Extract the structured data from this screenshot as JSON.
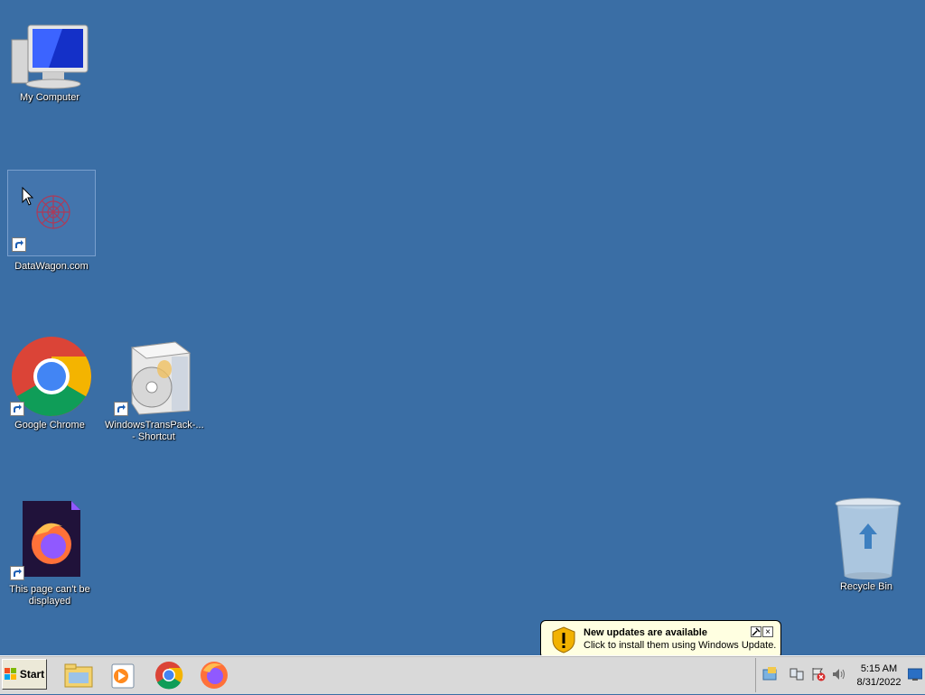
{
  "desktop": {
    "background": "#3a6ea5",
    "icons": [
      {
        "label": "My Computer",
        "icon": "computer-icon"
      },
      {
        "label": "DataWagon.com",
        "icon": "datawagon-icon"
      },
      {
        "label": "Google Chrome",
        "icon": "chrome-icon"
      },
      {
        "label": "WindowsTransPack-...\n- Shortcut",
        "icon": "installer-box-icon"
      },
      {
        "label": "This page can't be\ndisplayed",
        "icon": "firefox-doc-icon"
      },
      {
        "label": "Recycle Bin",
        "icon": "recycle-bin-icon"
      }
    ]
  },
  "taskbar": {
    "start_label": "Start",
    "pinned": [
      "file-explorer-icon",
      "media-player-icon",
      "chrome-icon",
      "firefox-icon"
    ],
    "clock": {
      "time": "5:15 AM",
      "date": "8/31/2022"
    }
  },
  "balloon": {
    "title": "New updates are available",
    "text": "Click to install them using Windows Update."
  }
}
